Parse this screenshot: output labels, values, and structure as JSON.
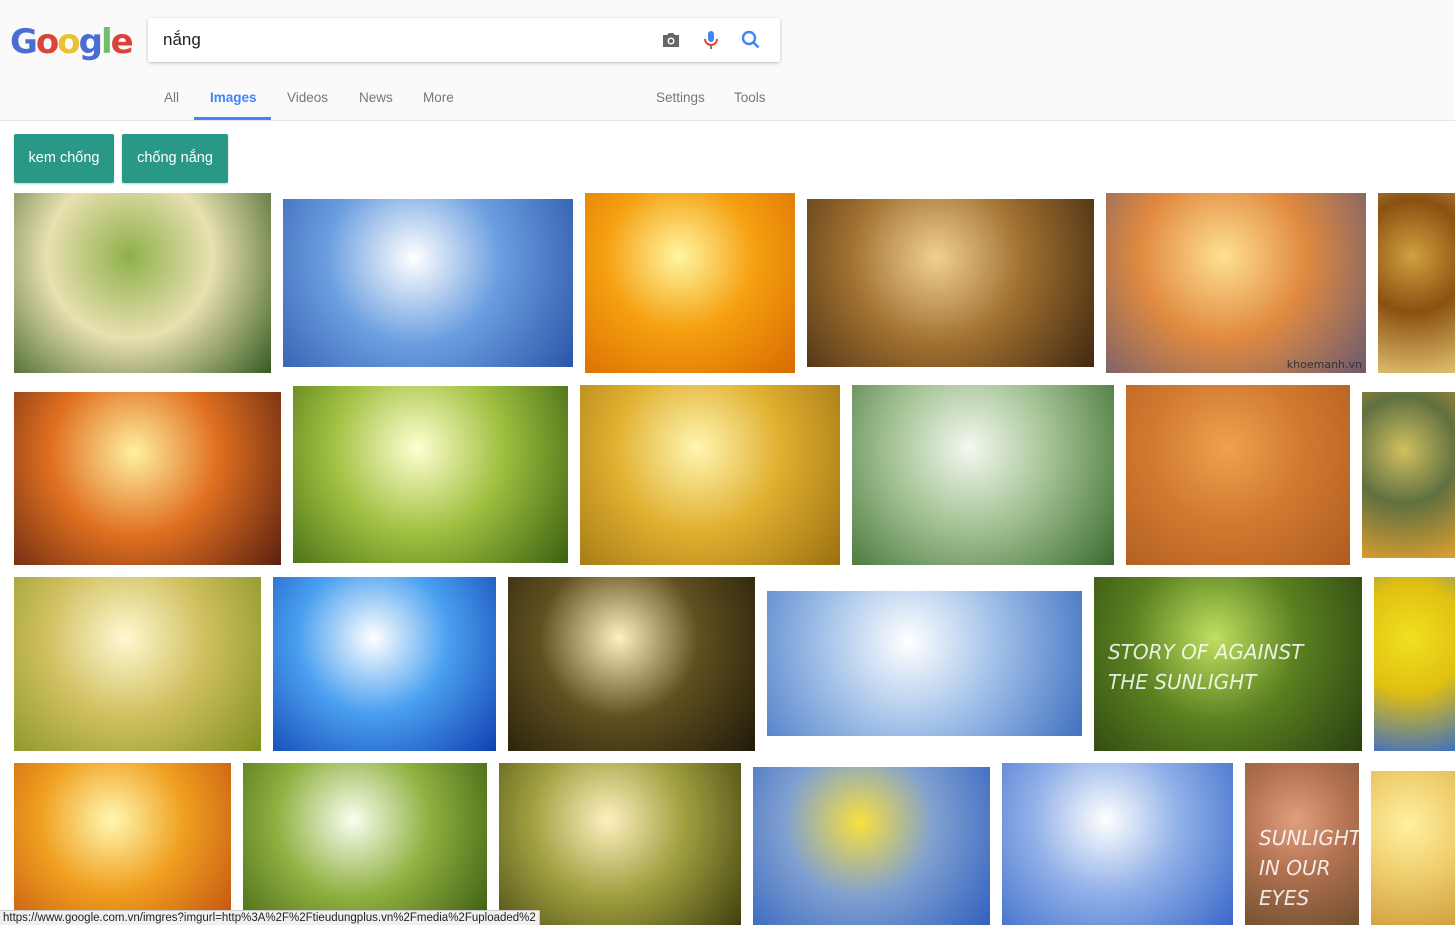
{
  "logo": {
    "text": "Google",
    "colors": [
      "#4a6cd4",
      "#d9443a",
      "#e8c32f",
      "#4a6cd4",
      "#6dbf6a",
      "#d9443a"
    ]
  },
  "search": {
    "query": "nắng",
    "camera_icon": "camera-icon",
    "mic_icon": "microphone-icon",
    "search_icon": "search-icon"
  },
  "tabs": [
    {
      "label": "All"
    },
    {
      "label": "Images",
      "active": true
    },
    {
      "label": "Videos"
    },
    {
      "label": "News"
    },
    {
      "label": "More"
    },
    {
      "label": "Settings"
    },
    {
      "label": "Tools"
    }
  ],
  "chips": [
    {
      "label": "kem chống"
    },
    {
      "label": "chống nắng"
    }
  ],
  "images": [
    {
      "colors": [
        "#8fb04a",
        "#e8e0b0",
        "#355a20"
      ]
    },
    {
      "colors": [
        "#ffffff",
        "#6a9ee0",
        "#2a55a8"
      ]
    },
    {
      "colors": [
        "#fff6a0",
        "#f5a010",
        "#d86a00"
      ]
    },
    {
      "colors": [
        "#f0d090",
        "#a07030",
        "#402810"
      ]
    },
    {
      "colors": [
        "#ffe090",
        "#e08a40",
        "#6a5a70"
      ],
      "watermark": "khoemanh.vn"
    },
    {
      "colors": [
        "#d0a040",
        "#8a5010",
        "#e0c070"
      ]
    },
    {
      "colors": [
        "#fff0a0",
        "#e07020",
        "#5a2010"
      ]
    },
    {
      "colors": [
        "#ffffd0",
        "#a0c040",
        "#3a6010"
      ]
    },
    {
      "colors": [
        "#fff6b0",
        "#e0b030",
        "#9a7010"
      ]
    },
    {
      "colors": [
        "#f4f8f0",
        "#a0c090",
        "#3a6a30"
      ]
    },
    {
      "colors": [
        "#f0a050",
        "#d07a30",
        "#b05a20"
      ]
    },
    {
      "colors": [
        "#d0c060",
        "#607040",
        "#e0a030"
      ]
    },
    {
      "colors": [
        "#fff8d0",
        "#d0c060",
        "#809020"
      ]
    },
    {
      "colors": [
        "#ffffff",
        "#4aa0f0",
        "#1040b0"
      ]
    },
    {
      "colors": [
        "#fff0c0",
        "#605020",
        "#201a08"
      ]
    },
    {
      "colors": [
        "#ffffff",
        "#a0c0e8",
        "#4070c0"
      ]
    },
    {
      "colors": [
        "#c0e060",
        "#5a8020",
        "#2a4010"
      ],
      "title": "STORY OF AGAINST THE SUNLIGHT"
    },
    {
      "colors": [
        "#f0e020",
        "#e0c010",
        "#4070c0"
      ]
    },
    {
      "colors": [
        "#fff8b0",
        "#f0a020",
        "#c05010"
      ]
    },
    {
      "colors": [
        "#f8fff0",
        "#90b040",
        "#3a5a10"
      ]
    },
    {
      "colors": [
        "#fff0c0",
        "#a0a040",
        "#404010"
      ]
    },
    {
      "colors": [
        "#f8e040",
        "#80a0d0",
        "#3060c0"
      ]
    },
    {
      "colors": [
        "#ffffff",
        "#90b0e8",
        "#3a68c8"
      ]
    },
    {
      "colors": [
        "#e0a080",
        "#b07050",
        "#705030"
      ],
      "title": "SUNLIGHT IN OUR EYES"
    },
    {
      "colors": [
        "#fff0a0",
        "#f0d070",
        "#d0a040"
      ]
    }
  ],
  "status_bar": {
    "url": "https://www.google.com.vn/imgres?imgurl=http%3A%2F%2Ftieudungplus.vn%2Fmedia%2Fuploaded%2"
  }
}
